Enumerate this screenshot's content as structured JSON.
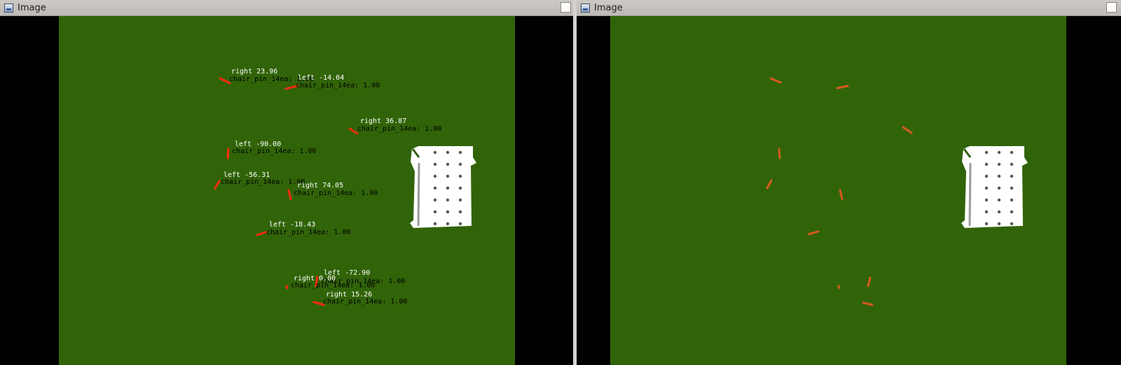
{
  "windows": [
    {
      "title": "Image",
      "detections": [
        {
          "direction_label": "right 23.96",
          "class_label": "chair_pin_14ea: 1.00"
        },
        {
          "direction_label": "left -14.04",
          "class_label": "chair_pin_14ea: 1.00"
        },
        {
          "direction_label": "right 36.87",
          "class_label": "chair_pin_14ea: 1.00"
        },
        {
          "direction_label": "left -90.00",
          "class_label": "chair_pin_14ea: 1.00"
        },
        {
          "direction_label": "left -56.31",
          "class_label": "chair_pin_14ea: 1.00"
        },
        {
          "direction_label": "right 74.05",
          "class_label": "chair_pin_14ea: 1.00"
        },
        {
          "direction_label": "left -18.43",
          "class_label": "chair_pin_14ea: 1.00"
        },
        {
          "direction_label": "left -72.90",
          "class_label": "chair_pin_14ea: 1.00"
        },
        {
          "direction_label": "right 0.00",
          "class_label": "chair_pin_14ea: 1.00"
        },
        {
          "direction_label": "right 15.26",
          "class_label": "chair_pin_14ea: 1.00"
        }
      ]
    },
    {
      "title": "Image"
    }
  ],
  "colors": {
    "field": "#316409",
    "pin": "#d45a1e",
    "pin_highlight": "#ff2a10",
    "tray": "#ffffff",
    "label_text": "#ffffff",
    "class_text": "#000000"
  }
}
